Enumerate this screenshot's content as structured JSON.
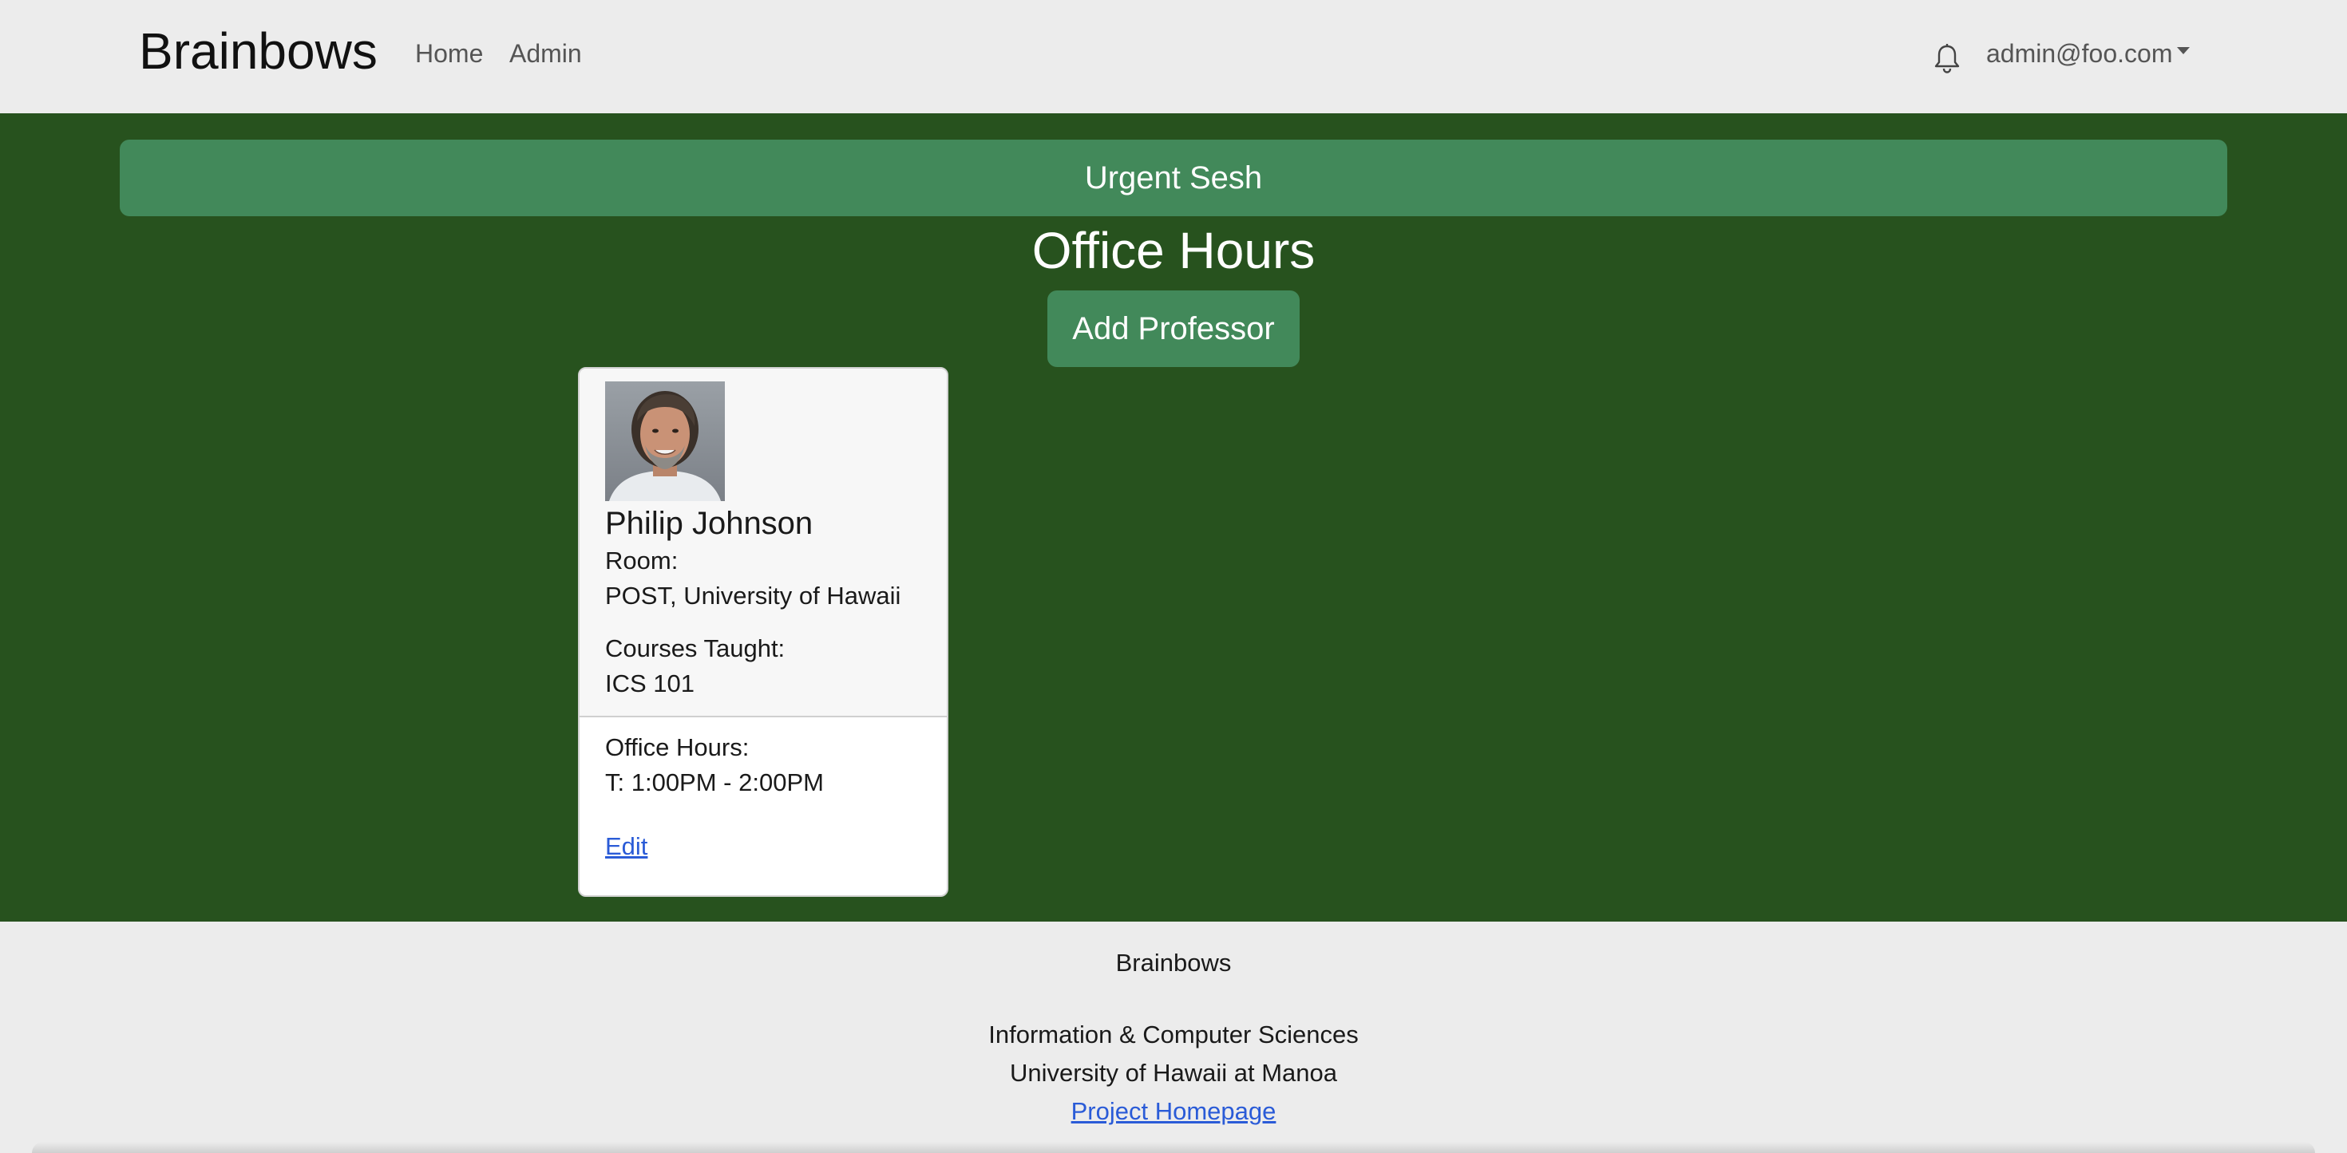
{
  "navbar": {
    "brand": "Brainbows",
    "links": [
      {
        "label": "Home"
      },
      {
        "label": "Admin"
      }
    ],
    "bell_icon": "bell-icon",
    "user_email": "admin@foo.com"
  },
  "main": {
    "urgent_button_label": "Urgent Sesh",
    "page_title": "Office Hours",
    "add_professor_label": "Add Professor",
    "background_color": "#27521e",
    "button_color": "#42895a"
  },
  "card": {
    "name": "Philip Johnson",
    "room_label": "Room:",
    "room_value": "POST, University of Hawaii",
    "courses_label": "Courses Taught:",
    "courses_value": "ICS 101",
    "hours_label": "Office Hours:",
    "hours_value": "T: 1:00PM - 2:00PM",
    "edit_label": "Edit",
    "photo_alt": "professor-photo"
  },
  "footer": {
    "brand": "Brainbows",
    "department": "Information & Computer Sciences",
    "university": "University of Hawaii at Manoa",
    "homepage_link": "Project Homepage"
  }
}
